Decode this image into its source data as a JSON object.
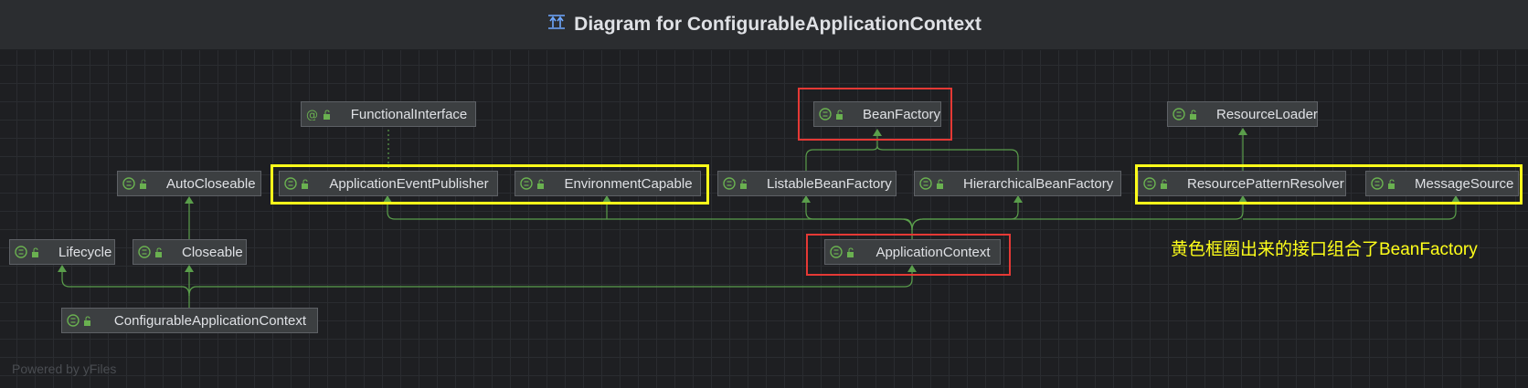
{
  "window": {
    "title": "Diagram for ConfigurableApplicationContext",
    "title_icon": "hierarchy-icon"
  },
  "nodes": {
    "functional_interface": {
      "label": "FunctionalInterface",
      "kind": "annotation"
    },
    "bean_factory": {
      "label": "BeanFactory",
      "kind": "interface"
    },
    "resource_loader": {
      "label": "ResourceLoader",
      "kind": "interface"
    },
    "auto_closeable": {
      "label": "AutoCloseable",
      "kind": "interface"
    },
    "application_event_publisher": {
      "label": "ApplicationEventPublisher",
      "kind": "interface"
    },
    "environment_capable": {
      "label": "EnvironmentCapable",
      "kind": "interface"
    },
    "listable_bean_factory": {
      "label": "ListableBeanFactory",
      "kind": "interface"
    },
    "hierarchical_bean_factory": {
      "label": "HierarchicalBeanFactory",
      "kind": "interface"
    },
    "resource_pattern_resolver": {
      "label": "ResourcePatternResolver",
      "kind": "interface"
    },
    "message_source": {
      "label": "MessageSource",
      "kind": "interface"
    },
    "lifecycle": {
      "label": "Lifecycle",
      "kind": "interface"
    },
    "closeable": {
      "label": "Closeable",
      "kind": "interface"
    },
    "application_context": {
      "label": "ApplicationContext",
      "kind": "interface"
    },
    "configurable_application_context": {
      "label": "ConfigurableApplicationContext",
      "kind": "interface"
    }
  },
  "annotation": {
    "text": "黄色框圈出来的接口组合了BeanFactory",
    "color": "#ffff1a"
  },
  "watermark": "Powered by yFiles",
  "colors": {
    "edge": "#5a9e4b",
    "highlight_red": "#e53935",
    "highlight_yellow": "#ffff1a",
    "node_bg": "#3c3f41",
    "canvas_bg": "#1e1f22"
  }
}
